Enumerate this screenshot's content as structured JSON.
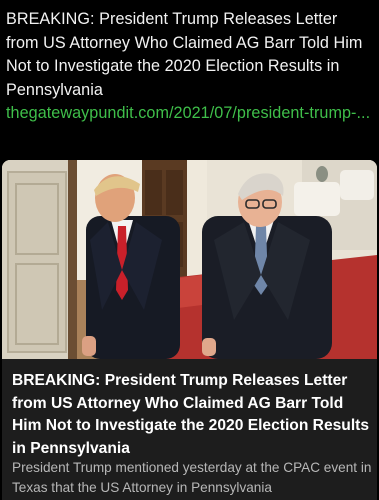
{
  "post": {
    "text": "BREAKING: President Trump Releases Letter from US Attorney Who Claimed AG Barr Told Him Not to Investigate the 2020 Election Results in Pennsylvania",
    "link_text": "thegatewaypundit.com/2021/07/president-trump-..."
  },
  "link_card": {
    "image_alt": "Photo of Donald Trump and William Barr walking",
    "title": "BREAKING: President Trump Releases Letter from US Attorney Who Claimed AG Barr Told Him Not to Investigate the 2020 Election Results in Pennsylvania",
    "description": "President Trump mentioned yesterday at the CPAC event in Texas that the US Attorney in Pennsylvania"
  },
  "colors": {
    "background": "#000000",
    "link": "#3fbf4a",
    "card_background": "#1d1d1d",
    "description_text": "#b7b7b7"
  }
}
